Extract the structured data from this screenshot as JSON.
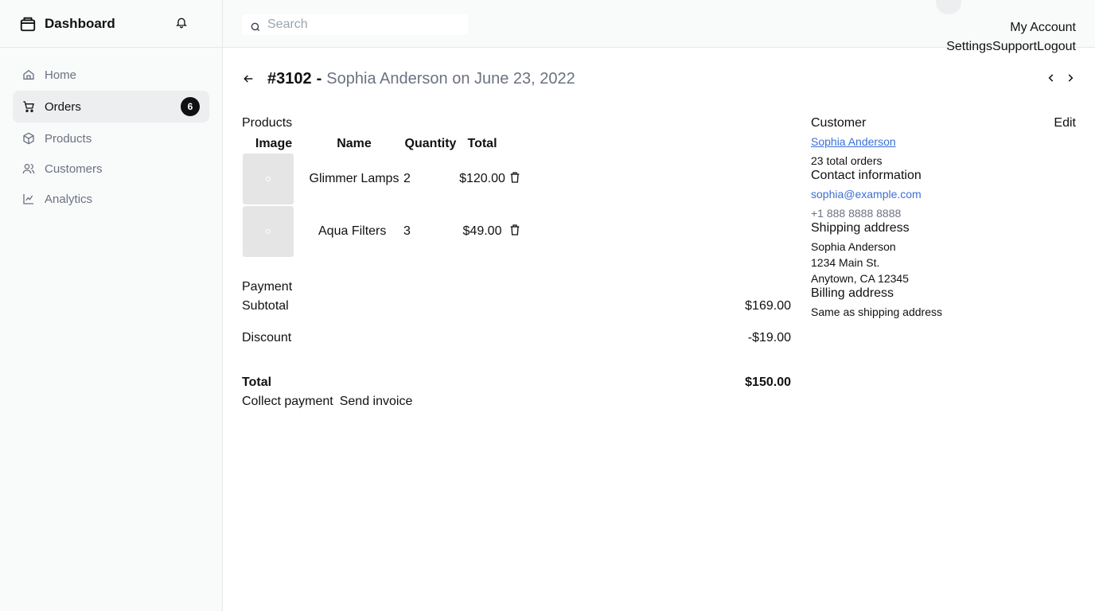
{
  "sidebar": {
    "brand": "Dashboard",
    "items": [
      {
        "label": "Home",
        "icon": "home-icon"
      },
      {
        "label": "Orders",
        "icon": "cart-icon",
        "badge": "6",
        "active": true
      },
      {
        "label": "Products",
        "icon": "package-icon"
      },
      {
        "label": "Customers",
        "icon": "users-icon"
      },
      {
        "label": "Analytics",
        "icon": "line-chart-icon"
      }
    ]
  },
  "topbar": {
    "search_placeholder": "Search",
    "account": "My Account",
    "links": [
      "Settings",
      "Support",
      "Logout"
    ]
  },
  "order": {
    "number": "#3102",
    "dash": "-",
    "subtitle": "Sophia Anderson on June 23, 2022"
  },
  "products": {
    "title": "Products",
    "headers": [
      "Image",
      "Name",
      "Quantity",
      "Total"
    ],
    "rows": [
      {
        "name": "Glimmer Lamps",
        "quantity": "2",
        "total": "$120.00"
      },
      {
        "name": "Aqua Filters",
        "quantity": "3",
        "total": "$49.00"
      }
    ]
  },
  "payment": {
    "title": "Payment",
    "subtotal_label": "Subtotal",
    "subtotal_value": "$169.00",
    "discount_label": "Discount",
    "discount_value": "-$19.00",
    "total_label": "Total",
    "total_value": "$150.00",
    "collect": "Collect payment",
    "invoice": "Send invoice"
  },
  "customer": {
    "title": "Customer",
    "edit": "Edit",
    "name": "Sophia Anderson",
    "orders": "23 total orders",
    "contact_title": "Contact information",
    "email": "sophia@example.com",
    "phone": "+1 888 8888 8888",
    "shipping_title": "Shipping address",
    "shipping_lines": [
      "Sophia Anderson",
      "1234 Main St.",
      "Anytown, CA 12345"
    ],
    "billing_title": "Billing address",
    "billing": "Same as shipping address"
  },
  "colors": {
    "link": "#3b6fd6",
    "muted": "#6b7280",
    "sidebar_bg": "#f9fafa"
  }
}
